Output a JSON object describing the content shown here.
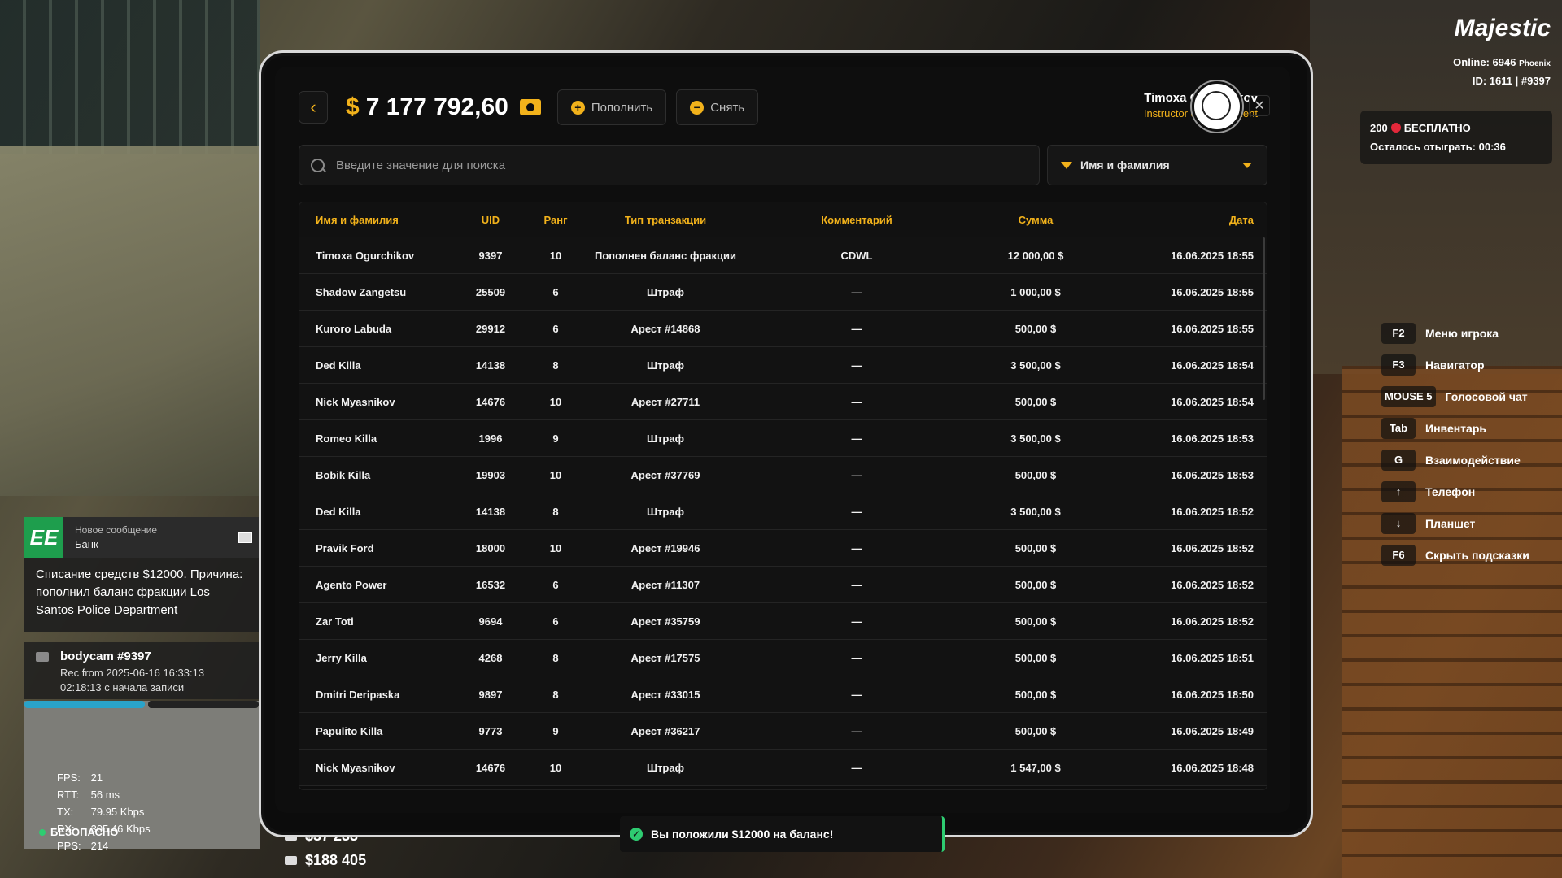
{
  "hud": {
    "logo": "Majestic",
    "online_label": "Online:",
    "online_count": "6946",
    "server": "Phoenix",
    "id_text": "ID: 1611 | #9397",
    "promo_points": "200",
    "promo_label": "БЕСПЛАТНО",
    "promo_timer_label": "Осталось отыграть:",
    "promo_timer": "00:36",
    "hints": [
      {
        "key": "F2",
        "label": "Меню игрока"
      },
      {
        "key": "F3",
        "label": "Навигатор"
      },
      {
        "key": "MOUSE 5",
        "label": "Голосовой чат"
      },
      {
        "key": "Tab",
        "label": "Инвентарь"
      },
      {
        "key": "G",
        "label": "Взаимодействие"
      },
      {
        "key": "↑",
        "label": "Телефон"
      },
      {
        "key": "↓",
        "label": "Планшет"
      },
      {
        "key": "F6",
        "label": "Скрыть подсказки"
      }
    ]
  },
  "tablet": {
    "currency": "$",
    "balance": "7 177 792,60",
    "deposit_label": "Пополнить",
    "withdraw_label": "Снять",
    "user_name": "Timoxa Ogurchikov",
    "user_role": "Instructor of Department",
    "search_placeholder": "Введите значение для поиска",
    "filter_label": "Имя и фамилия",
    "columns": [
      "Имя и фамилия",
      "UID",
      "Ранг",
      "Тип транзакции",
      "Комментарий",
      "Сумма",
      "Дата"
    ],
    "rows": [
      [
        "Timoxa Ogurchikov",
        "9397",
        "10",
        "Пополнен баланс фракции",
        "CDWL",
        "12 000,00 $",
        "16.06.2025 18:55"
      ],
      [
        "Shadow Zangetsu",
        "25509",
        "6",
        "Штраф",
        "—",
        "1 000,00 $",
        "16.06.2025 18:55"
      ],
      [
        "Kuroro Labuda",
        "29912",
        "6",
        "Арест #14868",
        "—",
        "500,00 $",
        "16.06.2025 18:55"
      ],
      [
        "Ded Killa",
        "14138",
        "8",
        "Штраф",
        "—",
        "3 500,00 $",
        "16.06.2025 18:54"
      ],
      [
        "Nick Myasnikov",
        "14676",
        "10",
        "Арест #27711",
        "—",
        "500,00 $",
        "16.06.2025 18:54"
      ],
      [
        "Romeo Killa",
        "1996",
        "9",
        "Штраф",
        "—",
        "3 500,00 $",
        "16.06.2025 18:53"
      ],
      [
        "Bobik Killa",
        "19903",
        "10",
        "Арест #37769",
        "—",
        "500,00 $",
        "16.06.2025 18:53"
      ],
      [
        "Ded Killa",
        "14138",
        "8",
        "Штраф",
        "—",
        "3 500,00 $",
        "16.06.2025 18:52"
      ],
      [
        "Pravik Ford",
        "18000",
        "10",
        "Арест #19946",
        "—",
        "500,00 $",
        "16.06.2025 18:52"
      ],
      [
        "Agento Power",
        "16532",
        "6",
        "Арест #11307",
        "—",
        "500,00 $",
        "16.06.2025 18:52"
      ],
      [
        "Zar Toti",
        "9694",
        "6",
        "Арест #35759",
        "—",
        "500,00 $",
        "16.06.2025 18:52"
      ],
      [
        "Jerry Killa",
        "4268",
        "8",
        "Арест #17575",
        "—",
        "500,00 $",
        "16.06.2025 18:51"
      ],
      [
        "Dmitri Deripaska",
        "9897",
        "8",
        "Арест #33015",
        "—",
        "500,00 $",
        "16.06.2025 18:50"
      ],
      [
        "Papulito Killa",
        "9773",
        "9",
        "Арест #36217",
        "—",
        "500,00 $",
        "16.06.2025 18:49"
      ],
      [
        "Nick Myasnikov",
        "14676",
        "10",
        "Штраф",
        "—",
        "1 547,00 $",
        "16.06.2025 18:48"
      ]
    ]
  },
  "notification": {
    "app_badge": "EE",
    "header": "Новое сообщение",
    "sender": "Банк",
    "body": "Списание средств $12000. Причина: пополнил баланс фракции Los Santos Police Department"
  },
  "bodycam": {
    "title": "bodycam #9397",
    "rec": "Rec from 2025-06-16 16:33:13",
    "elapsed": "02:18:13 с начала записи"
  },
  "netstats": {
    "fps_label": "FPS:",
    "fps": "21",
    "rtt_label": "RTT:",
    "rtt": "56 ms",
    "tx_label": "TX:",
    "tx": "79.95 Kbps",
    "rx_label": "RX:",
    "rx": "305.46 Kbps",
    "pps_label": "PPS:",
    "pps": "214",
    "zone": "БЕЗОПАСНО"
  },
  "wallet": {
    "cash": "$37 233",
    "bank": "$188 405"
  },
  "toast": {
    "message": "Вы положили $12000 на баланс!"
  },
  "colors": {
    "accent": "#f2b21b",
    "success": "#2ecc71",
    "panel": "#0e0e0e"
  }
}
